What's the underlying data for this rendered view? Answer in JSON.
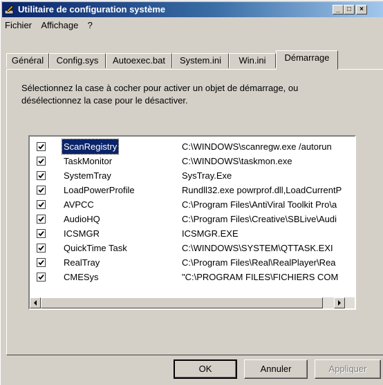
{
  "window": {
    "title": "Utilitaire de configuration système",
    "caption_buttons": [
      "_",
      "□",
      "×"
    ]
  },
  "menu": [
    {
      "label": "Fichier",
      "accel": "F"
    },
    {
      "label": "Affichage",
      "accel": "A"
    },
    {
      "label": "?",
      "accel": "?"
    }
  ],
  "tabs": [
    "Général",
    "Config.sys",
    "Autoexec.bat",
    "System.ini",
    "Win.ini",
    "Démarrage"
  ],
  "active_tab": "Démarrage",
  "instructions": "Sélectionnez la case à cocher pour activer un objet de démarrage, ou désélectionnez la case pour le désactiver.",
  "startup_items": [
    {
      "name": "ScanRegistry",
      "command": "C:\\WINDOWS\\scanregw.exe /autorun",
      "checked": true
    },
    {
      "name": "TaskMonitor",
      "command": "C:\\WINDOWS\\taskmon.exe",
      "checked": true
    },
    {
      "name": "SystemTray",
      "command": "SysTray.Exe",
      "checked": true
    },
    {
      "name": "LoadPowerProfile",
      "command": "Rundll32.exe powrprof.dll,LoadCurrentP",
      "checked": true
    },
    {
      "name": "AVPCC",
      "command": "C:\\Program Files\\AntiViral Toolkit Pro\\a",
      "checked": true
    },
    {
      "name": "AudioHQ",
      "command": "C:\\Program Files\\Creative\\SBLive\\Audi",
      "checked": true
    },
    {
      "name": "ICSMGR",
      "command": "ICSMGR.EXE",
      "checked": true
    },
    {
      "name": "QuickTime Task",
      "command": "C:\\WINDOWS\\SYSTEM\\QTTASK.EXI",
      "checked": true
    },
    {
      "name": "RealTray",
      "command": "C:\\Program Files\\Real\\RealPlayer\\Rea",
      "checked": true
    },
    {
      "name": "CMESys",
      "command": "\"C:\\PROGRAM FILES\\FICHIERS COM",
      "checked": true
    }
  ],
  "selected_item": "ScanRegistry",
  "buttons": {
    "ok": "OK",
    "cancel": "Annuler",
    "apply": "Appliquer"
  }
}
